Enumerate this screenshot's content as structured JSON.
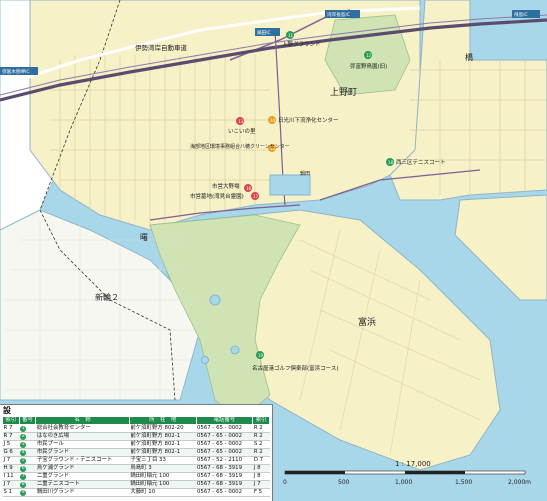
{
  "map": {
    "district_labels": [
      "上野町",
      "富浜",
      "新輪２",
      "曙",
      "橋"
    ],
    "road_labels": [
      "伊勢湾岸自動車道",
      "弥富木曽岬IC",
      "湾岸長島IC",
      "飛島IC",
      "鍋田IC",
      "鍋田"
    ],
    "places": [
      {
        "num": "11",
        "name": "上野グラウンド",
        "color": "#2a9a55"
      },
      {
        "num": "12",
        "name": "弥富野鳥園(旧)",
        "color": "#2a9a55"
      },
      {
        "num": "13",
        "name": "いこいの里",
        "color": "#d9434b"
      },
      {
        "num": "14",
        "name": "日光川下流浄化センター",
        "color": "#e8a020"
      },
      {
        "num": "15",
        "name": "海部地区環境事務組合八穂クリーンセンター",
        "color": "#e8a020"
      },
      {
        "num": "16",
        "name": "市営大野場",
        "color": "#d9434b"
      },
      {
        "num": "17",
        "name": "市営墓地(湾見台霊園)",
        "color": "#d9434b"
      },
      {
        "num": "18",
        "name": "西三区テニスコート",
        "color": "#2a9a55"
      },
      {
        "num": "19",
        "name": "名古屋港ゴルフ倶楽部(富浜コース)",
        "color": "#2a9a55"
      }
    ]
  },
  "legend": {
    "title": "設",
    "headers": [
      "電話番号",
      "索引",
      "番号",
      "名　称",
      "所　在　地",
      "電話番号",
      "索引"
    ],
    "rows": [
      {
        "phone1": "",
        "idx1": "R 7",
        "num": "1",
        "name": "総合社会教育センター",
        "addr": "前ケ須町野方 802-20",
        "phone": "0567 - 65 - 0002",
        "idx": "R 2"
      },
      {
        "phone1": "",
        "idx1": "R 7",
        "num": "2",
        "name": "はなのき広場",
        "addr": "前ケ須町野方 802-1",
        "phone": "0567 - 65 - 0002",
        "idx": "R 2"
      },
      {
        "phone1": "",
        "idx1": "J 5",
        "num": "3",
        "name": "市民プール",
        "addr": "前ケ須町野方 802-1",
        "phone": "0567 - 65 - 0002",
        "idx": "S 2"
      },
      {
        "phone1": "",
        "idx1": "G 6",
        "num": "4",
        "name": "市民グランド",
        "addr": "前ケ須町野方 802-1",
        "phone": "0567 - 65 - 0002",
        "idx": "R 2"
      },
      {
        "phone1": "",
        "idx1": "J 7",
        "num": "5",
        "name": "子宝グラウンド・テニスコート",
        "addr": "子宝三丁目 33",
        "phone": "0567 - 52 - 2110",
        "idx": "D 7"
      },
      {
        "phone1": "",
        "idx1": "H 9",
        "num": "6",
        "name": "鳥ケ浦グランド",
        "addr": "鳥島町 3",
        "phone": "0567 - 68 - 3919",
        "idx": "J 8"
      },
      {
        "phone1": "",
        "idx1": "I 11",
        "num": "7",
        "name": "二重グランド",
        "addr": "鍋田町稲元 100",
        "phone": "0567 - 68 - 3919",
        "idx": "J 8"
      },
      {
        "phone1": "",
        "idx1": "J 7",
        "num": "8",
        "name": "二重テニスコート",
        "addr": "鍋田町稲元 100",
        "phone": "0567 - 68 - 3919",
        "idx": "J 7"
      },
      {
        "phone1": "",
        "idx1": "S 1",
        "num": "9",
        "name": "鍋田川グランド",
        "addr": "大藤町 10",
        "phone": "0567 - 65 - 0002",
        "idx": "F 5"
      }
    ]
  },
  "scale": {
    "ratio": "1 : 17,000",
    "ticks": [
      "0",
      "500",
      "1,000",
      "1,500",
      "2,000m"
    ]
  },
  "colors": {
    "water": "#a9d7ea",
    "land": "#f6f1c7",
    "park": "#cfe3b4",
    "road_main": "#7d5f92",
    "expressway": "#5b4b6e",
    "badge_green": "#2a9a55"
  }
}
